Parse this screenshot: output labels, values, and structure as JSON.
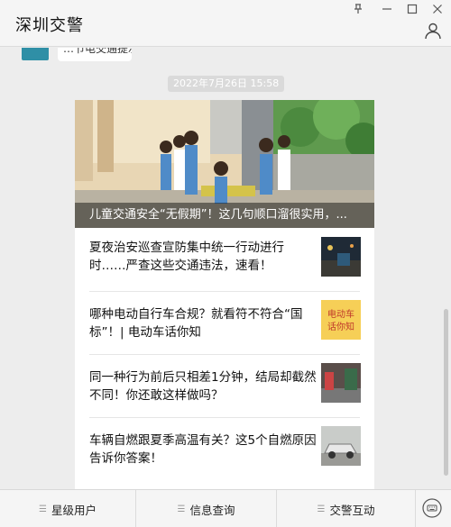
{
  "window": {
    "title": "深圳交警"
  },
  "previous_message": {
    "text_fragment": "…节电交通提示"
  },
  "message": {
    "timestamp": "2022年7月26日  15:58",
    "hero": {
      "caption": "儿童交通安全“无假期”！这几句顺口溜很实用，..."
    },
    "items": [
      {
        "title": "夏夜治安巡查宣防集中统一行动进行时……严查这些交通违法，速看！",
        "thumb": "night-street-thumbnail"
      },
      {
        "title": "哪种电动自行车合规？就看符不符合“国标”！| 电动车话你知",
        "thumb": "ebike-text-thumbnail",
        "thumb_text_1": "电动车",
        "thumb_text_2": "话你知"
      },
      {
        "title": "同一种行为前后只相差1分钟，结局却截然不同！你还敢这样做吗？",
        "thumb": "road-scene-thumbnail"
      },
      {
        "title": "车辆自燃跟夏季高温有关？这5个自燃原因告诉你答案！",
        "thumb": "car-thumbnail"
      }
    ]
  },
  "bottom_menu": {
    "items": [
      "星级用户",
      "信息查询",
      "交警互动"
    ]
  },
  "colors": {
    "ebike_thumb_bg": "#f6cf57",
    "caption_overlay": "#000000"
  }
}
